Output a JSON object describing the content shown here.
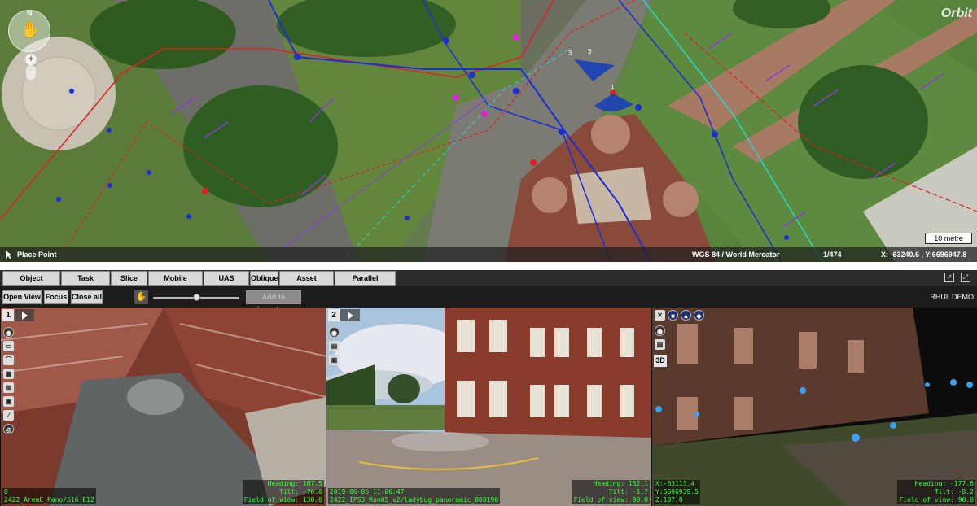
{
  "map": {
    "logo_text": "Orbit",
    "nav_north_label": "N",
    "zoom_plus": "+",
    "status": {
      "tool_label": "Place Point",
      "crs": "WGS 84 / World Mercator",
      "page": "1/474",
      "coordinates": "X: -63240.6 , Y:6696947.8"
    },
    "scale_label": "10 metre",
    "marker_labels": [
      "3",
      "3",
      "1"
    ]
  },
  "tabs": [
    {
      "label": "Object Inspector"
    },
    {
      "label": "Task Manager"
    },
    {
      "label": "Slice View"
    },
    {
      "label": "Mobile Mapping"
    },
    {
      "label": "UAS Mapping"
    },
    {
      "label": "Oblique"
    },
    {
      "label": "Asset Inventory"
    },
    {
      "label": "Parallel Extraction"
    }
  ],
  "toolbar": {
    "open_view": "Open View",
    "focus": "Focus",
    "close_all": "Close all",
    "add_to_inventory": "Add to inventory",
    "zoom_slider_value": 0.5,
    "project_name": "RHUL DEMO"
  },
  "panes": [
    {
      "number": "1",
      "hud_left_line1": "0",
      "hud_left_line2": "2422_AreaE_Pano/516 E12",
      "heading": "Heading: 167.5",
      "tilt": "Tilt: -76.0",
      "fov": "Field of view: 130.0"
    },
    {
      "number": "2",
      "hud_left_line1": "2019-06-05 11:06:47",
      "hud_left_line2": "2422_IPS3_Run05_v2/ladybug_panoramic_000190",
      "heading": "Heading: 152.1",
      "tilt": "Tilt: -1.7",
      "fov": "Field of view: 90.0"
    },
    {
      "number": "3D",
      "hud_left_line1": "X:-63113.4",
      "hud_left_line2": "Y:6696939.5",
      "hud_left_line3": "Z:107.0",
      "heading": "Heading: -177.6",
      "tilt": "Tilt: -8.2",
      "fov": "Field of view: 90.0"
    }
  ],
  "colors": {
    "hud_text": "#3cff3c",
    "utility_red": "#e02020",
    "utility_blue": "#1a2fd6",
    "utility_purple": "#8a3bd6",
    "utility_cyan": "#27d6c8",
    "marker_magenta": "#e022d6"
  }
}
